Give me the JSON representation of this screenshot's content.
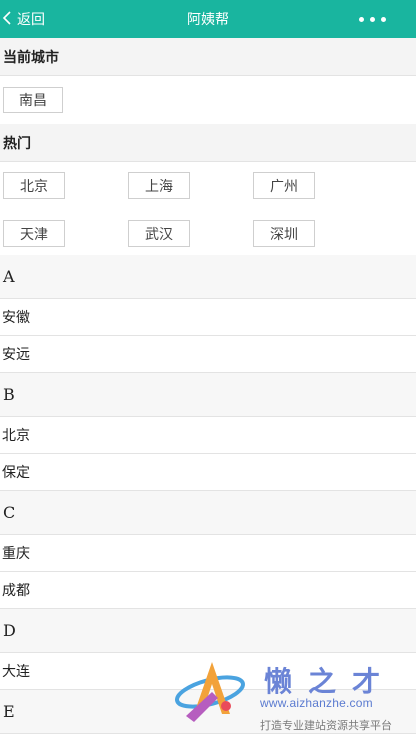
{
  "topbar": {
    "back_label": "返回",
    "title": "阿姨帮"
  },
  "current": {
    "title": "当前城市",
    "city": "南昌"
  },
  "hot": {
    "title": "热门",
    "cities": [
      "北京",
      "上海",
      "广州",
      "天津",
      "武汉",
      "深圳"
    ]
  },
  "groups": [
    {
      "letter": "A",
      "cities": [
        "安徽",
        "安远"
      ]
    },
    {
      "letter": "B",
      "cities": [
        "北京",
        "保定"
      ]
    },
    {
      "letter": "C",
      "cities": [
        "重庆",
        "成都"
      ]
    },
    {
      "letter": "D",
      "cities": [
        "大连"
      ]
    },
    {
      "letter": "E",
      "cities": []
    }
  ],
  "watermark": {
    "brand": "懒之才",
    "url": "www.aizhanzhe.com",
    "tagline": "打造专业建站资源共享平台"
  },
  "colors": {
    "accent": "#19b59f"
  }
}
